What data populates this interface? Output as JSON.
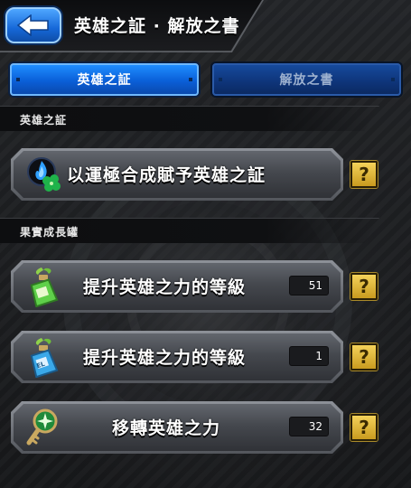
{
  "header": {
    "title": "英雄之証 · 解放之書",
    "back_icon": "back-arrow-icon"
  },
  "tabs": [
    {
      "label": "英雄之証",
      "active": true
    },
    {
      "label": "解放之書",
      "active": false
    }
  ],
  "sections": [
    {
      "title": "英雄之証",
      "items": [
        {
          "label": "以運極合成賦予英雄之証",
          "icon": "hero-flame-clover-icon",
          "count": null,
          "help": "?"
        }
      ]
    },
    {
      "title": "果實成長罐",
      "items": [
        {
          "label": "提升英雄之力的等級",
          "icon": "green-bottle-icon",
          "count": "51",
          "help": "?"
        },
        {
          "label": "提升英雄之力的等級",
          "icon": "blue-el-bottle-icon",
          "count": "1",
          "help": "?"
        },
        {
          "label": "移轉英雄之力",
          "icon": "green-key-icon",
          "count": "32",
          "help": "?"
        }
      ]
    }
  ],
  "colors": {
    "accent_blue": "#0a5fd8",
    "help_gold": "#e0b63a",
    "row_gray": "#45484e"
  }
}
